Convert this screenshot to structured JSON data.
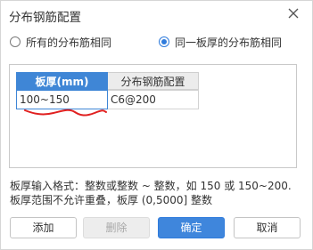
{
  "dialog": {
    "title": "分布钢筋配置"
  },
  "options": [
    {
      "label": "所有的分布筋相同",
      "selected": false
    },
    {
      "label": "同一板厚的分布筋相同",
      "selected": true
    }
  ],
  "table": {
    "headers": [
      "板厚(mm)",
      "分布钢筋配置"
    ],
    "rows": [
      [
        "100~150",
        "C6@200"
      ]
    ]
  },
  "hint": {
    "line1": "板厚输入格式：整数或整数 ~ 整数，如 150 或 150~200.",
    "line2": "板厚范围不允许重叠，板厚 (0,5000] 整数"
  },
  "buttons": {
    "add": "添加",
    "delete": "删除",
    "ok": "确定",
    "cancel": "取消"
  },
  "colors": {
    "accent": "#3f86dc",
    "annotation": "#e02020"
  }
}
